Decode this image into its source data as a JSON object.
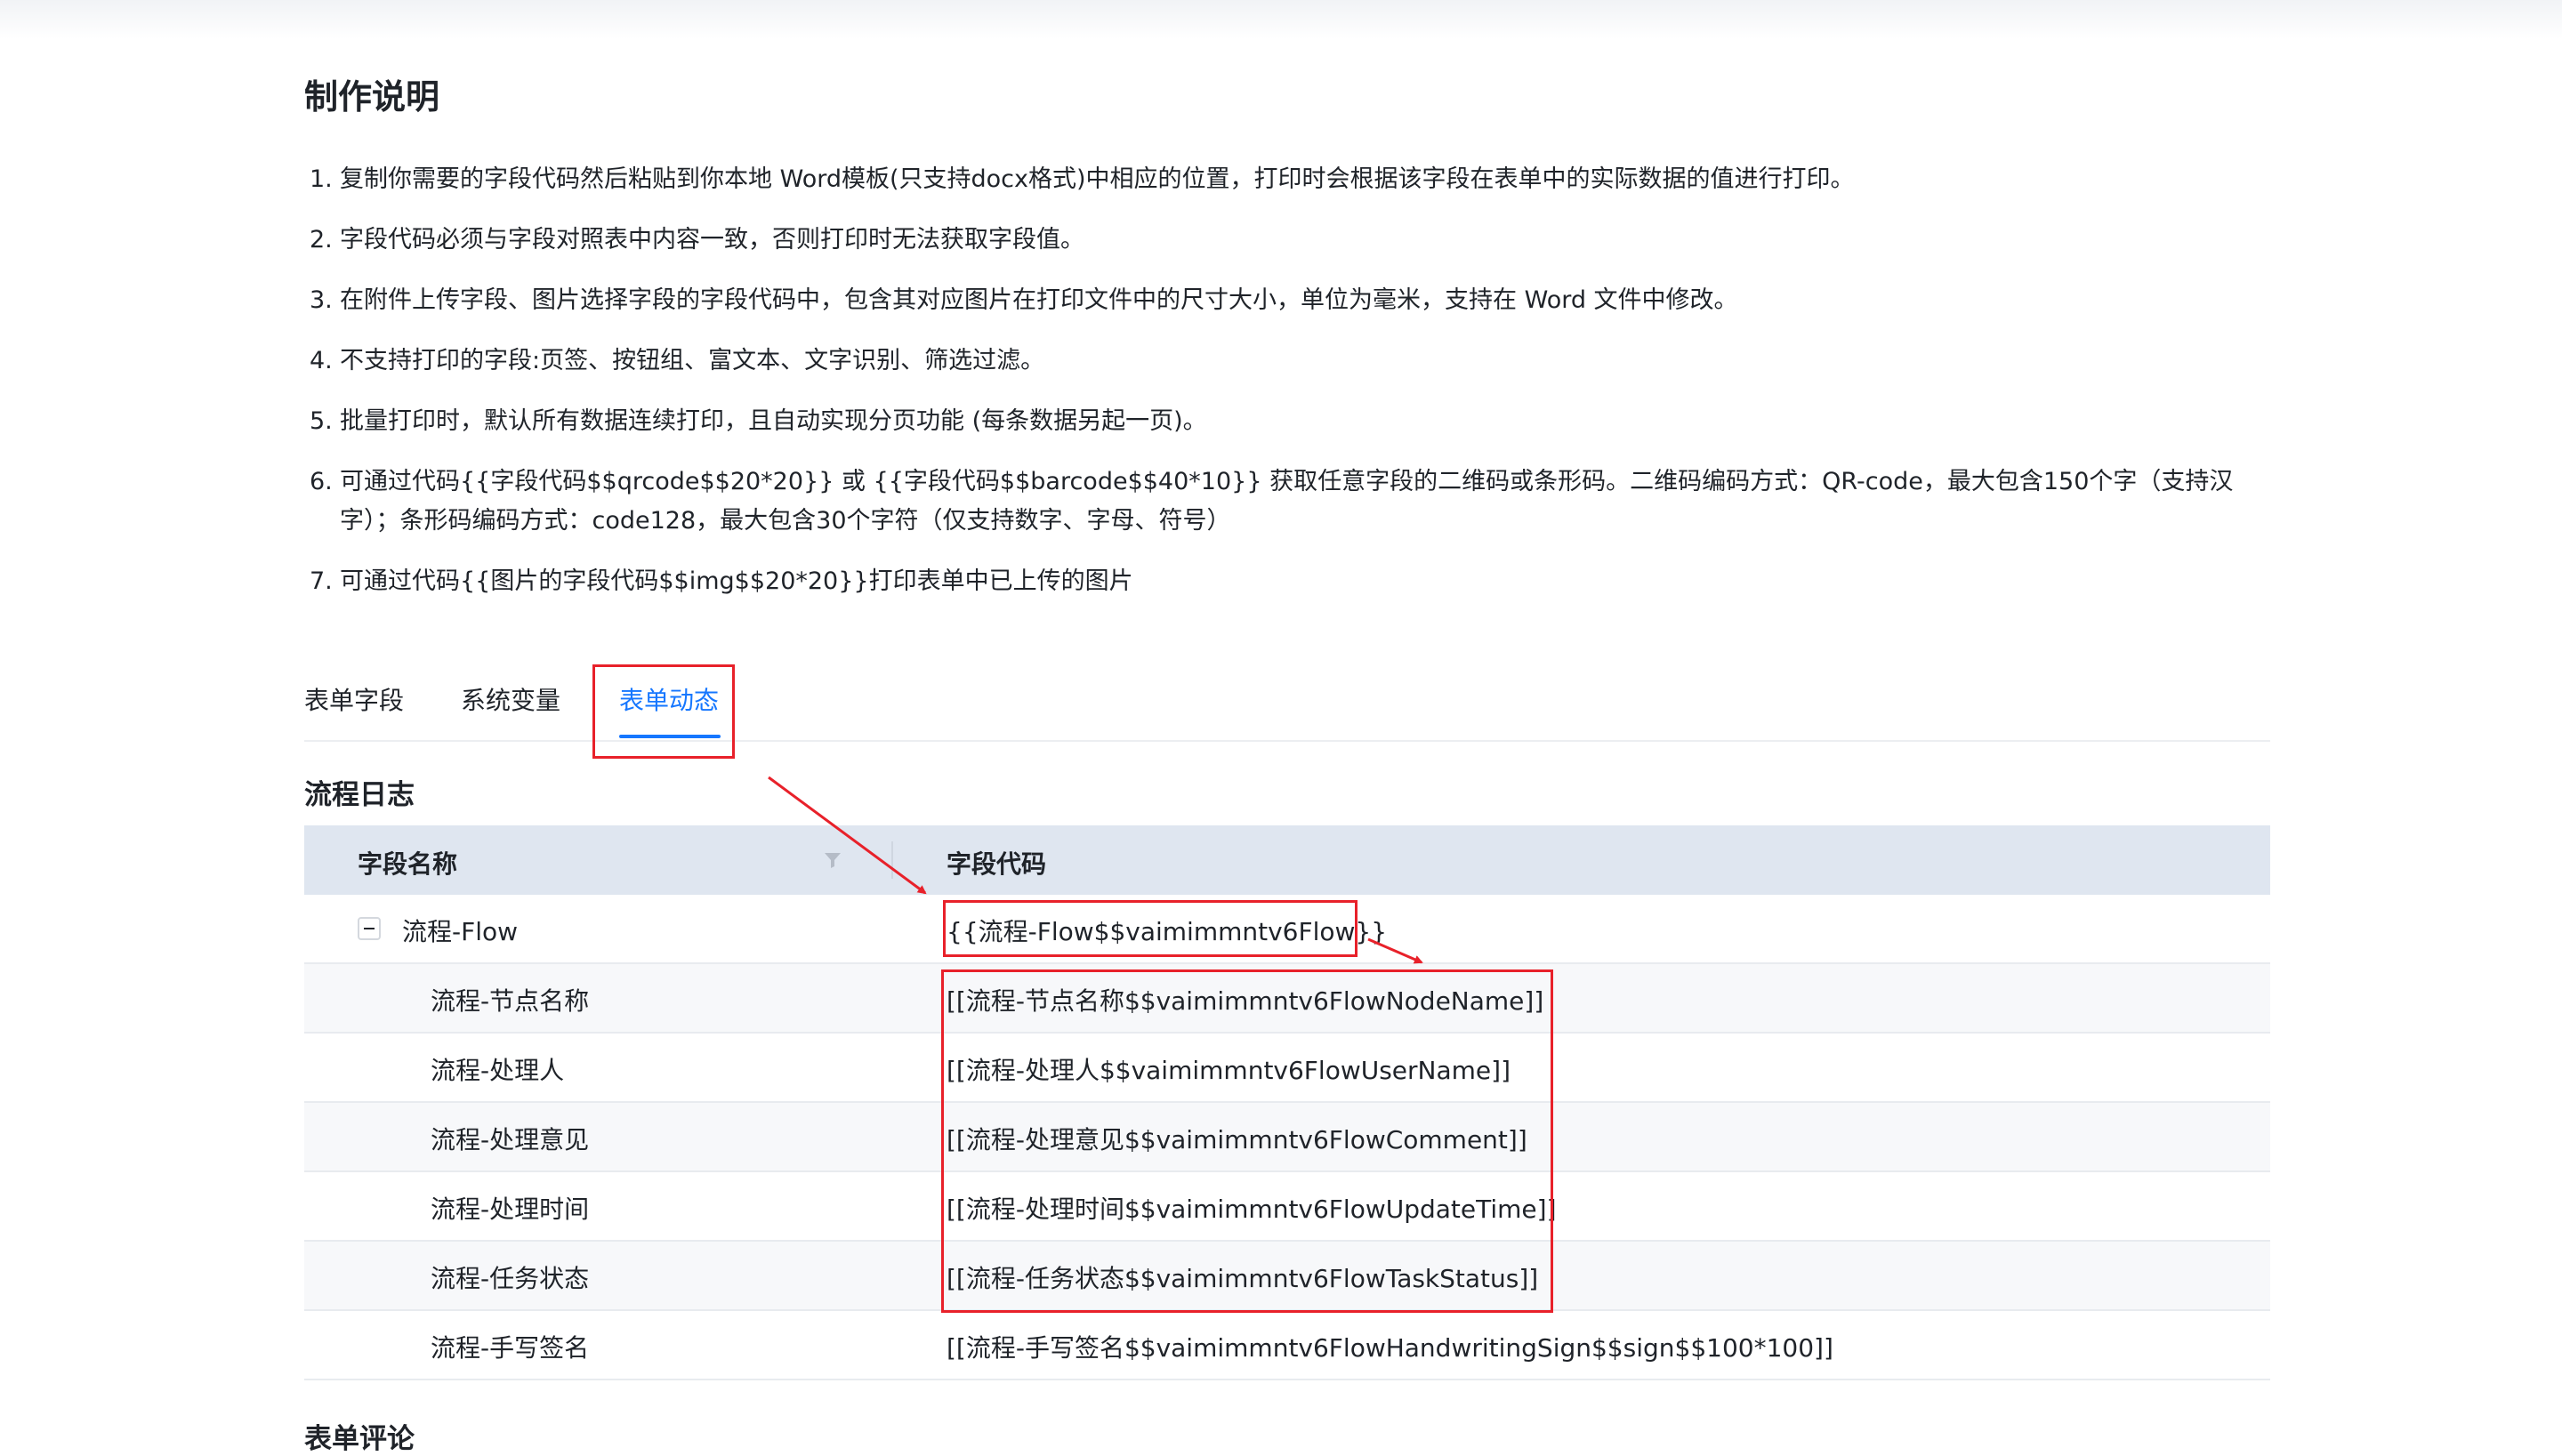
{
  "page_title": "制作说明",
  "instructions": [
    {
      "num": "1.",
      "text": "复制你需要的字段代码然后粘贴到你本地 Word模板(只支持docx格式)中相应的位置，打印时会根据该字段在表单中的实际数据的值进行打印。"
    },
    {
      "num": "2.",
      "text": "字段代码必须与字段对照表中内容一致，否则打印时无法获取字段值。"
    },
    {
      "num": "3.",
      "text": "在附件上传字段、图片选择字段的字段代码中，包含其对应图片在打印文件中的尺寸大小，单位为毫米，支持在 Word 文件中修改。"
    },
    {
      "num": "4.",
      "text": "不支持打印的字段:页签、按钮组、富文本、文字识别、筛选过滤。"
    },
    {
      "num": "5.",
      "text": "批量打印时，默认所有数据连续打印，且自动实现分页功能 (每条数据另起一页)。"
    },
    {
      "num": "6.",
      "text": "可通过代码{{字段代码$$qrcode$$20*20}} 或 {{字段代码$$barcode$$40*10}} 获取任意字段的二维码或条形码。二维码编码方式：QR-code，最大包含150个字（支持汉字）；条形码编码方式：code128，最大包含30个字符（仅支持数字、字母、符号）"
    },
    {
      "num": "7.",
      "text": "可通过代码{{图片的字段代码$$img$$20*20}}打印表单中已上传的图片"
    }
  ],
  "tabs": [
    {
      "label": "表单字段",
      "active": false
    },
    {
      "label": "系统变量",
      "active": false
    },
    {
      "label": "表单动态",
      "active": true
    }
  ],
  "sections": {
    "flow_log_title": "流程日志",
    "form_comment_title": "表单评论"
  },
  "table": {
    "header_name": "字段名称",
    "header_code": "字段代码",
    "rows": [
      {
        "name": "流程-Flow",
        "code": "{{流程-Flow$$vaimimmntv6Flow}}",
        "parent": true
      },
      {
        "name": "流程-节点名称",
        "code": "[[流程-节点名称$$vaimimmntv6FlowNodeName]]",
        "parent": false
      },
      {
        "name": "流程-处理人",
        "code": "[[流程-处理人$$vaimimmntv6FlowUserName]]",
        "parent": false
      },
      {
        "name": "流程-处理意见",
        "code": "[[流程-处理意见$$vaimimmntv6FlowComment]]",
        "parent": false
      },
      {
        "name": "流程-处理时间",
        "code": "[[流程-处理时间$$vaimimmntv6FlowUpdateTime]]",
        "parent": false
      },
      {
        "name": "流程-任务状态",
        "code": "[[流程-任务状态$$vaimimmntv6FlowTaskStatus]]",
        "parent": false
      },
      {
        "name": "流程-手写签名",
        "code": "[[流程-手写签名$$vaimimmntv6FlowHandwritingSign$$sign$$100*100]]",
        "parent": false
      }
    ]
  },
  "colors": {
    "accent": "#1677ff",
    "annotation_red": "#e8212a",
    "table_header_bg": "#dfe6f0"
  }
}
